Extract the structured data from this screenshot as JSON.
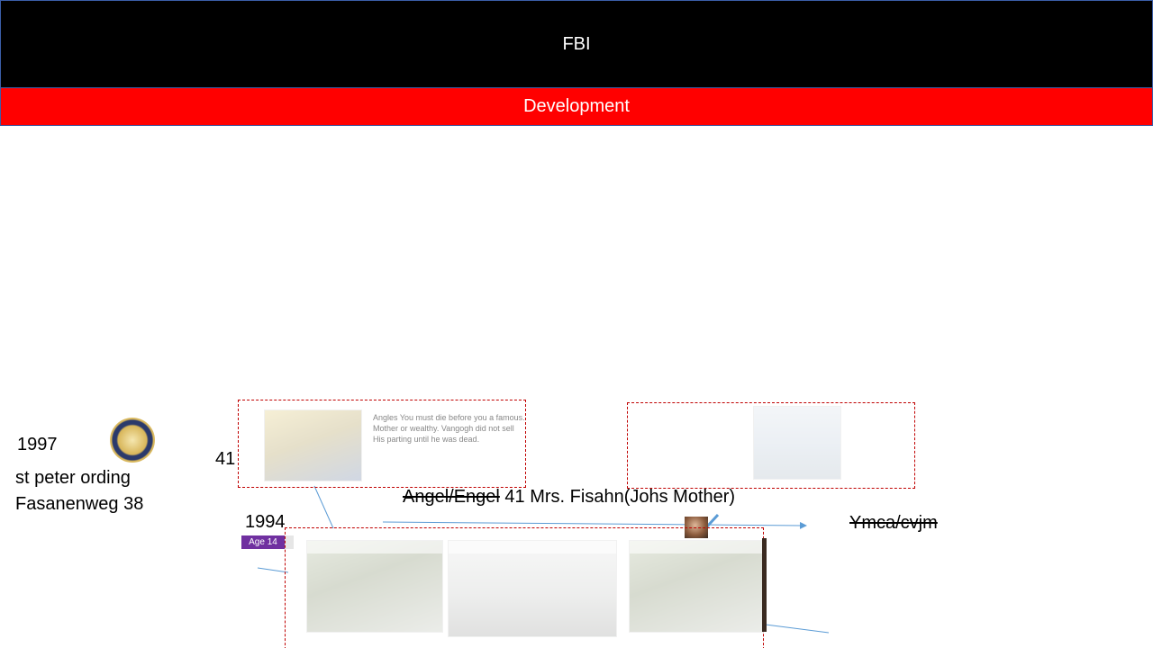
{
  "header": {
    "title": "FBI",
    "subtitle": "Development"
  },
  "labels": {
    "year_1997": "1997",
    "place_line1": "st peter ording",
    "place_line2": "Fasanenweg 38",
    "number_41": "41",
    "year_1994": "1994",
    "angel_struck": "Angel/Engel",
    "angel_rest": " 41 Mrs. Fisahn(Johs Mother)",
    "ymca": "Ymca/cvjm",
    "age_badge": "Age 14"
  },
  "caption": {
    "line1": "Angles You must die before you a famous.",
    "line2": "Mother or wealthy. Vangogh did not sell",
    "line3": "His parting until he was dead."
  },
  "colors": {
    "title_bg": "#000000",
    "subtitle_bg": "#ff0000",
    "badge_bg": "#7030a0",
    "dashed_border": "#c00000",
    "connector": "#5b9bd5"
  },
  "icons": {
    "seal": "university-seal-icon",
    "avatar": "person-photo-icon"
  }
}
